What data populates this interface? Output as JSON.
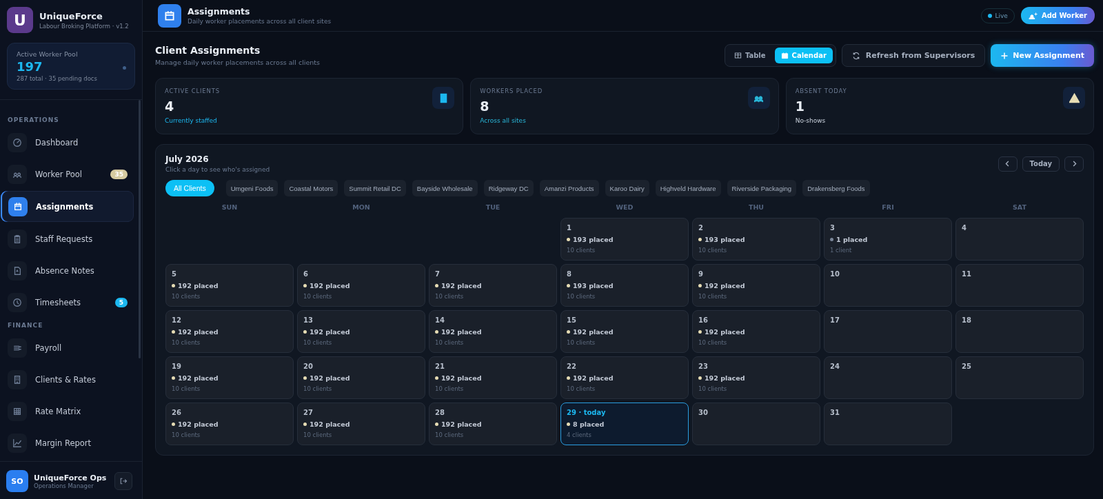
{
  "brand": {
    "name": "UniqueForce",
    "subtitle": "Labour Broking Platform · v1.2",
    "logo_letter": "U"
  },
  "pool": {
    "label": "Active Worker Pool",
    "value": "197",
    "detail": "287 total · 35 pending docs"
  },
  "sidebar": {
    "sections": [
      {
        "title": "OPERATIONS",
        "items": [
          {
            "label": "Dashboard",
            "selected": false
          },
          {
            "label": "Worker Pool",
            "selected": false,
            "badge": "35",
            "color": "#d6cba0"
          },
          {
            "label": "Assignments",
            "selected": true
          },
          {
            "label": "Staff Requests",
            "selected": false
          },
          {
            "label": "Absence Notes",
            "selected": false
          },
          {
            "label": "Timesheets",
            "selected": false,
            "badge": "5",
            "color": "#1cb8f0"
          }
        ]
      },
      {
        "title": "FINANCE",
        "items": [
          {
            "label": "Payroll",
            "selected": false
          },
          {
            "label": "Clients & Rates",
            "selected": false
          },
          {
            "label": "Rate Matrix",
            "selected": false
          },
          {
            "label": "Margin Report",
            "selected": false
          }
        ]
      }
    ]
  },
  "user": {
    "initials": "SO",
    "name": "UniqueForce Ops",
    "role": "Operations Manager"
  },
  "topbar": {
    "title": "Assignments",
    "subtitle": "Daily worker placements across all client sites",
    "status": "Live",
    "action": "Add Worker"
  },
  "page": {
    "title": "Client Assignments",
    "subtitle": "Manage daily worker placements across all clients",
    "views": [
      {
        "label": "Table",
        "selected": false
      },
      {
        "label": "Calendar",
        "selected": true
      }
    ],
    "refresh": "Refresh from Supervisors",
    "primary": "New Assignment"
  },
  "stats": [
    {
      "label": "ACTIVE CLIENTS",
      "value": "4",
      "note": "Currently staffed",
      "color": "#1cb8f0"
    },
    {
      "label": "WORKERS PLACED",
      "value": "8",
      "note": "Across all sites",
      "color": "#29b6d8"
    },
    {
      "label": "ABSENT TODAY",
      "value": "1",
      "note": "No-shows",
      "color": "#e6dcb4"
    }
  ],
  "calendar": {
    "month": "July 2026",
    "hint": "Click a day to see who's assigned",
    "today_button": "Today",
    "filters": [
      {
        "label": "All Clients",
        "selected": true
      },
      {
        "label": "Umgeni Foods",
        "selected": false
      },
      {
        "label": "Coastal Motors",
        "selected": false
      },
      {
        "label": "Summit Retail DC",
        "selected": false
      },
      {
        "label": "Bayside Wholesale",
        "selected": false
      },
      {
        "label": "Ridgeway DC",
        "selected": false
      },
      {
        "label": "Amanzi Products",
        "selected": false
      },
      {
        "label": "Karoo Dairy",
        "selected": false
      },
      {
        "label": "Highveld Hardware",
        "selected": false
      },
      {
        "label": "Riverside Packaging",
        "selected": false
      },
      {
        "label": "Drakensberg Foods",
        "selected": false
      }
    ],
    "weekdays": [
      "SUN",
      "MON",
      "TUE",
      "WED",
      "THU",
      "FRI",
      "SAT"
    ],
    "days": [
      {
        "label": "1",
        "placed": "193 placed",
        "clients": "10 clients",
        "color": "#e6dcb4",
        "today": false
      },
      {
        "label": "2",
        "placed": "193 placed",
        "clients": "10 clients",
        "color": "#e6dcb4",
        "today": false
      },
      {
        "label": "3",
        "placed": "1 placed",
        "clients": "1 client",
        "color": "#7a8699",
        "today": false
      },
      {
        "label": "4",
        "today": false
      },
      {
        "label": "5",
        "placed": "192 placed",
        "clients": "10 clients",
        "color": "#e6dcb4",
        "today": false
      },
      {
        "label": "6",
        "placed": "192 placed",
        "clients": "10 clients",
        "color": "#e6dcb4",
        "today": false
      },
      {
        "label": "7",
        "placed": "192 placed",
        "clients": "10 clients",
        "color": "#e6dcb4",
        "today": false
      },
      {
        "label": "8",
        "placed": "193 placed",
        "clients": "10 clients",
        "color": "#e6dcb4",
        "today": false
      },
      {
        "label": "9",
        "placed": "192 placed",
        "clients": "10 clients",
        "color": "#e6dcb4",
        "today": false
      },
      {
        "label": "10",
        "today": false
      },
      {
        "label": "11",
        "today": false
      },
      {
        "label": "12",
        "placed": "192 placed",
        "clients": "10 clients",
        "color": "#e6dcb4",
        "today": false
      },
      {
        "label": "13",
        "placed": "192 placed",
        "clients": "10 clients",
        "color": "#e6dcb4",
        "today": false
      },
      {
        "label": "14",
        "placed": "192 placed",
        "clients": "10 clients",
        "color": "#e6dcb4",
        "today": false
      },
      {
        "label": "15",
        "placed": "192 placed",
        "clients": "10 clients",
        "color": "#e6dcb4",
        "today": false
      },
      {
        "label": "16",
        "placed": "192 placed",
        "clients": "10 clients",
        "color": "#e6dcb4",
        "today": false
      },
      {
        "label": "17",
        "today": false
      },
      {
        "label": "18",
        "today": false
      },
      {
        "label": "19",
        "placed": "192 placed",
        "clients": "10 clients",
        "color": "#e6dcb4",
        "today": false
      },
      {
        "label": "20",
        "placed": "192 placed",
        "clients": "10 clients",
        "color": "#e6dcb4",
        "today": false
      },
      {
        "label": "21",
        "placed": "192 placed",
        "clients": "10 clients",
        "color": "#e6dcb4",
        "today": false
      },
      {
        "label": "22",
        "placed": "192 placed",
        "clients": "10 clients",
        "color": "#e6dcb4",
        "today": false
      },
      {
        "label": "23",
        "placed": "192 placed",
        "clients": "10 clients",
        "color": "#e6dcb4",
        "today": false
      },
      {
        "label": "24",
        "today": false
      },
      {
        "label": "25",
        "today": false
      },
      {
        "label": "26",
        "placed": "192 placed",
        "clients": "10 clients",
        "color": "#e6dcb4",
        "today": false
      },
      {
        "label": "27",
        "placed": "192 placed",
        "clients": "10 clients",
        "color": "#e6dcb4",
        "today": false
      },
      {
        "label": "28",
        "placed": "192 placed",
        "clients": "10 clients",
        "color": "#e6dcb4",
        "today": false
      },
      {
        "label": "29 · today",
        "placed": "8 placed",
        "clients": "4 clients",
        "color": "#e6dcb4",
        "today": true
      },
      {
        "label": "30",
        "today": false
      },
      {
        "label": "31",
        "today": false
      }
    ]
  }
}
